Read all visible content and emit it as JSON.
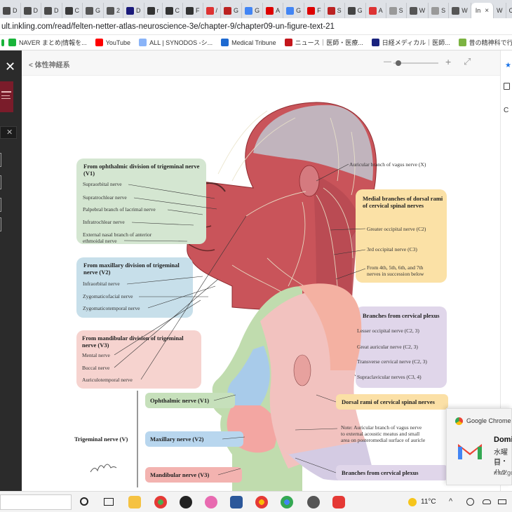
{
  "browser": {
    "tabs": [
      {
        "label": "D",
        "color": "#4a4a4a"
      },
      {
        "label": "D",
        "color": "#4a4a4a"
      },
      {
        "label": "D",
        "color": "#4a4a4a"
      },
      {
        "label": "C",
        "color": "#3a3a3a"
      },
      {
        "label": "G",
        "color": "#555"
      },
      {
        "label": "2",
        "color": "#555"
      },
      {
        "label": "D",
        "color": "#1a1a7a"
      },
      {
        "label": "r",
        "color": "#333"
      },
      {
        "label": "C",
        "color": "#333"
      },
      {
        "label": "F",
        "color": "#333"
      },
      {
        "label": "/",
        "color": "#d33"
      },
      {
        "label": "G",
        "color": "#b22"
      },
      {
        "label": "G",
        "color": "#4285f4"
      },
      {
        "label": "A",
        "color": "#d00"
      },
      {
        "label": "G",
        "color": "#4285f4"
      },
      {
        "label": "F",
        "color": "#d00"
      },
      {
        "label": "S",
        "color": "#b22"
      },
      {
        "label": "G",
        "color": "#444"
      },
      {
        "label": "A",
        "color": "#d33"
      },
      {
        "label": "S",
        "color": "#999"
      },
      {
        "label": "W",
        "color": "#555"
      },
      {
        "label": "S",
        "color": "#999"
      },
      {
        "label": "W",
        "color": "#555"
      }
    ],
    "active_tab": {
      "label": "In",
      "close": "×"
    },
    "after_tabs": [
      {
        "label": "W"
      },
      {
        "label": "C"
      }
    ],
    "url": "ult.inkling.com/read/felten-netter-atlas-neuroscience-3e/chapter-9/chapter09-un-figure-text-21",
    "bookmarks": [
      {
        "label": "NAVER まとめ|情報を...",
        "color": "#19b43a"
      },
      {
        "label": "YouTube",
        "color": "#ff0000"
      },
      {
        "label": "ALL | SYNODOS -シ...",
        "color": "#8ab4f8"
      },
      {
        "label": "Medical Tribune",
        "color": "#1e6ad1"
      },
      {
        "label": "ニュース｜医師・医療...",
        "color": "#c4161c"
      },
      {
        "label": "日経メディカル｜医師...",
        "color": "#1a237e"
      },
      {
        "label": "昔の精神科で行われ...",
        "color": "#7cb342"
      }
    ],
    "bookmarks_more": "»"
  },
  "reader": {
    "back_label": "< 体性神経系",
    "zoom_minus": "—",
    "zoom_plus": "+",
    "right_rail_char": "C"
  },
  "figure_top": {
    "ophthalmic_title": "From ophthalmic division of trigeminal nerve (V1)",
    "ophthalmic_items": [
      "Supraorbital nerve",
      "Supratrochlear nerve",
      "Palpebral branch of lacrimal nerve",
      "Infratrochlear nerve",
      "External nasal branch of anterior",
      "ethmoidal nerve"
    ],
    "maxillary_title": "From maxillary division of trigeminal nerve (V2)",
    "maxillary_items": [
      "Infraorbital nerve",
      "Zygomaticofacial nerve",
      "Zygomaticotemporal nerve"
    ],
    "mandibular_title": "From mandibular division of trigeminal nerve (V3)",
    "mandibular_items": [
      "Mental nerve",
      "Buccal nerve",
      "Auriculotemporal nerve"
    ],
    "auricular_label": "Auricular branch of vagus nerve (X)",
    "dorsal_title": "Medial branches of dorsal rami of cervical spinal nerves",
    "dorsal_items": [
      "Greater occipital nerve (C2)",
      "3rd occipital nerve (C3)",
      "From 4th, 5th, 6th, and 7th",
      "nerves in succession below"
    ],
    "plexus_title": "Branches from cervical plexus",
    "plexus_items": [
      "Lesser occipital nerve (C2, 3)",
      "Great auricular nerve (C2, 3)",
      "Transverse cervical nerve (C2, 3)",
      "Supraclavicular nerves (C3, 4)"
    ]
  },
  "figure_bottom": {
    "trigeminal_label": "Trigeminal nerve (V)",
    "v1": "Ophthalmic nerve (V1)",
    "v2": "Maxillary nerve (V2)",
    "v3": "Mandibular nerve (V3)",
    "dorsal": "Dorsal rami of cervical spinal nerves",
    "note": [
      "Note: Auricular branch of vagus nerve",
      "to external acoustic meatus and small",
      "area on posteromedial surface of auricle"
    ],
    "plexus": "Branches from cervical plexus",
    "signature": "F.Netter"
  },
  "notification": {
    "app": "Google Chrome",
    "title": "Domi",
    "line1": "水曜日",
    "line2": "ロ・ハッ",
    "source": "mail.go"
  },
  "taskbar": {
    "temp": "11°C"
  }
}
